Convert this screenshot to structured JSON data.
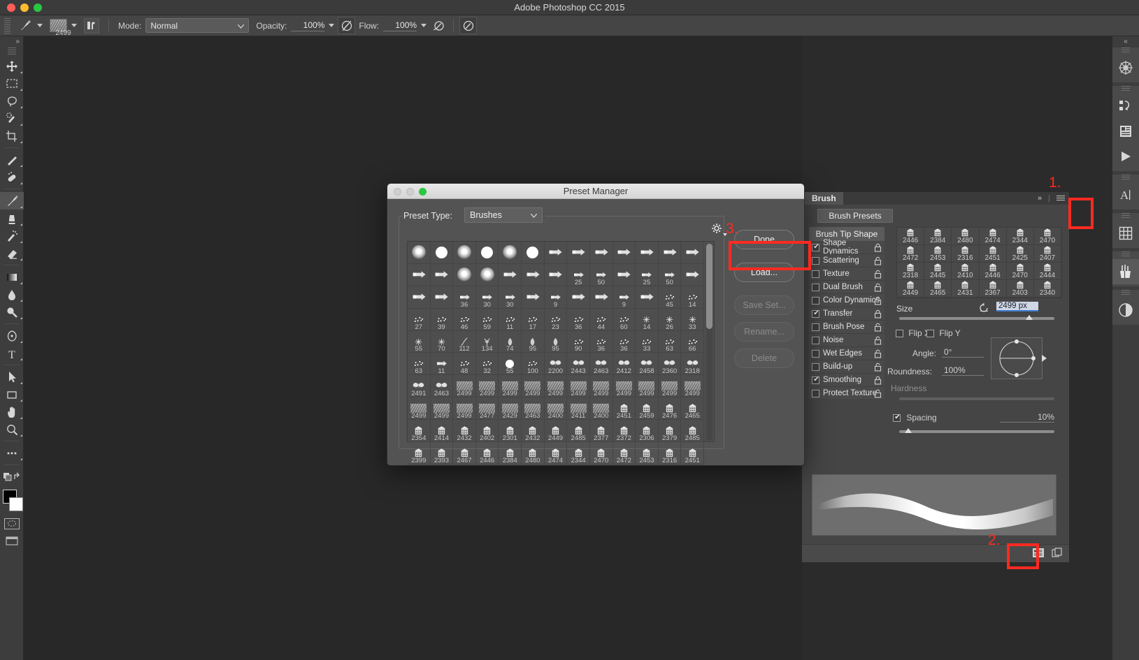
{
  "window": {
    "app_title": "Adobe Photoshop CC 2015"
  },
  "options_bar": {
    "brush_preset_size": "2499",
    "mode_label": "Mode:",
    "mode_value": "Normal",
    "opacity_label": "Opacity:",
    "opacity_value": "100%",
    "flow_label": "Flow:",
    "flow_value": "100%",
    "icons": {
      "brush_tool": "brush-icon",
      "brush_preset": "brush-preset-thumbnail",
      "toggle_brush_panel": "brush-panel-toggle-icon",
      "airbrush": "airbrush-icon",
      "tablet_pressure_opacity": "tablet-pressure-opacity-icon",
      "tablet_pressure_size": "tablet-pressure-size-icon",
      "smoothing_options": "smoothing-options-icon"
    }
  },
  "toolbar": {
    "collapse": "»",
    "tools": [
      {
        "name": "move-tool",
        "glyph": "move"
      },
      {
        "name": "rectangular-marquee-tool",
        "glyph": "marquee"
      },
      {
        "name": "lasso-tool",
        "glyph": "lasso"
      },
      {
        "name": "quick-selection-tool",
        "glyph": "quickselect"
      },
      {
        "name": "crop-tool",
        "glyph": "crop"
      },
      {
        "name": "eyedropper-tool",
        "glyph": "eyedropper"
      },
      {
        "name": "spot-healing-brush-tool",
        "glyph": "healing"
      },
      {
        "name": "brush-tool",
        "glyph": "brush",
        "selected": true
      },
      {
        "name": "clone-stamp-tool",
        "glyph": "stamp"
      },
      {
        "name": "history-brush-tool",
        "glyph": "historybrush"
      },
      {
        "name": "eraser-tool",
        "glyph": "eraser"
      },
      {
        "name": "gradient-tool",
        "glyph": "gradient"
      },
      {
        "name": "blur-tool",
        "glyph": "blur"
      },
      {
        "name": "dodge-tool",
        "glyph": "dodge"
      },
      {
        "name": "pen-tool",
        "glyph": "pen"
      },
      {
        "name": "type-tool",
        "glyph": "type"
      },
      {
        "name": "path-selection-tool",
        "glyph": "pathselect"
      },
      {
        "name": "rectangle-tool",
        "glyph": "rect"
      },
      {
        "name": "hand-tool",
        "glyph": "hand"
      },
      {
        "name": "zoom-tool",
        "glyph": "zoom"
      },
      {
        "name": "edit-toolbar-button",
        "glyph": "ellipsis"
      }
    ],
    "foreground_color": "#000000",
    "background_color": "#ffffff"
  },
  "preset_manager": {
    "title": "Preset Manager",
    "preset_type_label": "Preset Type:",
    "preset_type_value": "Brushes",
    "gear_icon": "gear-icon",
    "buttons": [
      {
        "label": "Done",
        "enabled": true
      },
      {
        "label": "Load...",
        "enabled": true
      },
      {
        "label": "Save Set...",
        "enabled": false
      },
      {
        "label": "Rename...",
        "enabled": false
      },
      {
        "label": "Delete",
        "enabled": false
      }
    ],
    "brush_rows": [
      [
        {
          "k": "soft",
          "n": ""
        },
        {
          "k": "hard",
          "n": ""
        },
        {
          "k": "soft",
          "n": ""
        },
        {
          "k": "hard",
          "n": ""
        },
        {
          "k": "soft",
          "n": ""
        },
        {
          "k": "hard",
          "n": ""
        },
        {
          "k": "flat",
          "n": ""
        },
        {
          "k": "flat",
          "n": ""
        },
        {
          "k": "flat",
          "n": ""
        },
        {
          "k": "flat",
          "n": ""
        },
        {
          "k": "flat",
          "n": ""
        },
        {
          "k": "flat",
          "n": ""
        },
        {
          "k": "flat",
          "n": ""
        }
      ],
      [
        {
          "k": "flat",
          "n": ""
        },
        {
          "k": "flat",
          "n": ""
        },
        {
          "k": "soft",
          "n": ""
        },
        {
          "k": "soft",
          "n": ""
        },
        {
          "k": "flat",
          "n": ""
        },
        {
          "k": "flat",
          "n": ""
        },
        {
          "k": "flat",
          "n": ""
        },
        {
          "k": "flat",
          "n": "25"
        },
        {
          "k": "flat",
          "n": "50"
        },
        {
          "k": "flat",
          "n": ""
        },
        {
          "k": "flat",
          "n": "25"
        },
        {
          "k": "flat",
          "n": "50"
        },
        {
          "k": "flat",
          "n": ""
        }
      ],
      [
        {
          "k": "flat",
          "n": ""
        },
        {
          "k": "flat",
          "n": ""
        },
        {
          "k": "flat",
          "n": "36"
        },
        {
          "k": "flat",
          "n": "30"
        },
        {
          "k": "flat",
          "n": "30"
        },
        {
          "k": "flat",
          "n": ""
        },
        {
          "k": "flat",
          "n": "9"
        },
        {
          "k": "flat",
          "n": ""
        },
        {
          "k": "flat",
          "n": ""
        },
        {
          "k": "flat",
          "n": "9"
        },
        {
          "k": "flat",
          "n": ""
        },
        {
          "k": "spray",
          "n": "45"
        },
        {
          "k": "spray",
          "n": "14"
        }
      ],
      [
        {
          "k": "spray",
          "n": "27"
        },
        {
          "k": "spray",
          "n": "39"
        },
        {
          "k": "spray",
          "n": "46"
        },
        {
          "k": "spray",
          "n": "59"
        },
        {
          "k": "spray",
          "n": "11"
        },
        {
          "k": "spray",
          "n": "17"
        },
        {
          "k": "spray",
          "n": "23"
        },
        {
          "k": "spray",
          "n": "36"
        },
        {
          "k": "spray",
          "n": "44"
        },
        {
          "k": "spray",
          "n": "60"
        },
        {
          "k": "dot",
          "n": "14"
        },
        {
          "k": "dot",
          "n": "26"
        },
        {
          "k": "dot",
          "n": "33"
        }
      ],
      [
        {
          "k": "dot",
          "n": "55"
        },
        {
          "k": "dot",
          "n": "70"
        },
        {
          "k": "stroke",
          "n": "112"
        },
        {
          "k": "grass",
          "n": "134"
        },
        {
          "k": "leaf",
          "n": "74"
        },
        {
          "k": "leaf",
          "n": "95"
        },
        {
          "k": "leaf",
          "n": "95"
        },
        {
          "k": "spray",
          "n": "90"
        },
        {
          "k": "spray",
          "n": "36"
        },
        {
          "k": "spray",
          "n": "36"
        },
        {
          "k": "spray",
          "n": "33"
        },
        {
          "k": "spray",
          "n": "63"
        },
        {
          "k": "spray",
          "n": "66"
        }
      ],
      [
        {
          "k": "spray",
          "n": "63"
        },
        {
          "k": "flat",
          "n": "11"
        },
        {
          "k": "spray",
          "n": "48"
        },
        {
          "k": "spray",
          "n": "32"
        },
        {
          "k": "hard",
          "n": "55"
        },
        {
          "k": "spray",
          "n": "100"
        },
        {
          "k": "moth",
          "n": "2200"
        },
        {
          "k": "moth",
          "n": "2443"
        },
        {
          "k": "moth",
          "n": "2463"
        },
        {
          "k": "moth",
          "n": "2412"
        },
        {
          "k": "moth",
          "n": "2458"
        },
        {
          "k": "moth",
          "n": "2360"
        },
        {
          "k": "moth",
          "n": "2318"
        }
      ],
      [
        {
          "k": "moth",
          "n": "2491"
        },
        {
          "k": "moth",
          "n": "2463"
        },
        {
          "k": "tex",
          "n": "2499"
        },
        {
          "k": "tex",
          "n": "2499"
        },
        {
          "k": "tex",
          "n": "2499"
        },
        {
          "k": "tex",
          "n": "2499"
        },
        {
          "k": "tex",
          "n": "2499"
        },
        {
          "k": "tex",
          "n": "2499"
        },
        {
          "k": "tex",
          "n": "2499"
        },
        {
          "k": "tex",
          "n": "2499"
        },
        {
          "k": "tex",
          "n": "2499"
        },
        {
          "k": "tex",
          "n": "2499"
        },
        {
          "k": "tex",
          "n": "2499"
        }
      ],
      [
        {
          "k": "tex",
          "n": "2499"
        },
        {
          "k": "tex",
          "n": "2499"
        },
        {
          "k": "tex",
          "n": "2499"
        },
        {
          "k": "tex",
          "n": "2477"
        },
        {
          "k": "tex",
          "n": "2429"
        },
        {
          "k": "tex",
          "n": "2463"
        },
        {
          "k": "tex",
          "n": "2400"
        },
        {
          "k": "tex",
          "n": "2411"
        },
        {
          "k": "tex",
          "n": "2400"
        },
        {
          "k": "bldg",
          "n": "2451"
        },
        {
          "k": "bldg",
          "n": "2459"
        },
        {
          "k": "bldg",
          "n": "2476"
        },
        {
          "k": "bldg",
          "n": "2465"
        }
      ],
      [
        {
          "k": "bldg",
          "n": "2354"
        },
        {
          "k": "bldg",
          "n": "2414"
        },
        {
          "k": "bldg",
          "n": "2432"
        },
        {
          "k": "bldg",
          "n": "2402"
        },
        {
          "k": "bldg",
          "n": "2301"
        },
        {
          "k": "bldg",
          "n": "2432"
        },
        {
          "k": "bldg",
          "n": "2449"
        },
        {
          "k": "bldg",
          "n": "2485"
        },
        {
          "k": "bldg",
          "n": "2377"
        },
        {
          "k": "bldg",
          "n": "2372"
        },
        {
          "k": "bldg",
          "n": "2306"
        },
        {
          "k": "bldg",
          "n": "2379"
        },
        {
          "k": "bldg",
          "n": "2485"
        }
      ],
      [
        {
          "k": "bldg",
          "n": "2399"
        },
        {
          "k": "bldg",
          "n": "2393"
        },
        {
          "k": "bldg",
          "n": "2467"
        },
        {
          "k": "bldg",
          "n": "2446"
        },
        {
          "k": "bldg",
          "n": "2384"
        },
        {
          "k": "bldg",
          "n": "2480"
        },
        {
          "k": "bldg",
          "n": "2474"
        },
        {
          "k": "bldg",
          "n": "2344"
        },
        {
          "k": "bldg",
          "n": "2470"
        },
        {
          "k": "bldg",
          "n": "2472"
        },
        {
          "k": "bldg",
          "n": "2453"
        },
        {
          "k": "bldg",
          "n": "2316"
        },
        {
          "k": "bldg",
          "n": "2451"
        }
      ]
    ]
  },
  "brush_panel": {
    "tab_label": "Brush",
    "collapse_icon": "»",
    "menu_icon": "panel-menu-icon",
    "presets_button": "Brush Presets",
    "tip_shape_header": "Brush Tip Shape",
    "options": [
      {
        "label": "Shape Dynamics",
        "checked": true
      },
      {
        "label": "Scattering",
        "checked": false
      },
      {
        "label": "Texture",
        "checked": false
      },
      {
        "label": "Dual Brush",
        "checked": false
      },
      {
        "label": "Color Dynamics",
        "checked": false
      },
      {
        "label": "Transfer",
        "checked": true
      },
      {
        "label": "Brush Pose",
        "checked": false
      },
      {
        "label": "Noise",
        "checked": false
      },
      {
        "label": "Wet Edges",
        "checked": false
      },
      {
        "label": "Build-up",
        "checked": false
      },
      {
        "label": "Smoothing",
        "checked": true
      },
      {
        "label": "Protect Texture",
        "checked": false
      }
    ],
    "tip_grid": [
      [
        {
          "n": "2446"
        },
        {
          "n": "2384"
        },
        {
          "n": "2480"
        },
        {
          "n": "2474"
        },
        {
          "n": "2344"
        },
        {
          "n": "2470"
        }
      ],
      [
        {
          "n": "2472"
        },
        {
          "n": "2453"
        },
        {
          "n": "2316"
        },
        {
          "n": "2451"
        },
        {
          "n": "2425"
        },
        {
          "n": "2407"
        }
      ],
      [
        {
          "n": "2318"
        },
        {
          "n": "2445"
        },
        {
          "n": "2410"
        },
        {
          "n": "2446"
        },
        {
          "n": "2470"
        },
        {
          "n": "2444"
        }
      ],
      [
        {
          "n": "2449"
        },
        {
          "n": "2465"
        },
        {
          "n": "2431"
        },
        {
          "n": "2367"
        },
        {
          "n": "2403"
        },
        {
          "n": "2340"
        }
      ]
    ],
    "size_label": "Size",
    "size_value": "2499 px",
    "reset_icon": "reset-arrow-icon",
    "flip_x_label": "Flip X",
    "flip_x_checked": false,
    "flip_y_label": "Flip Y",
    "flip_y_checked": false,
    "angle_label": "Angle:",
    "angle_value": "0°",
    "roundness_label": "Roundness:",
    "roundness_value": "100%",
    "hardness_label": "Hardness",
    "spacing_label": "Spacing",
    "spacing_checked": true,
    "spacing_value": "10%",
    "footer_icons": [
      {
        "name": "toggle-brush-settings-icon"
      },
      {
        "name": "new-brush-preset-icon"
      }
    ]
  },
  "icon_dock": {
    "collapse_icon": "«",
    "groups": [
      [
        {
          "name": "3d-panel-icon"
        }
      ],
      [
        {
          "name": "history-panel-icon"
        },
        {
          "name": "properties-panel-icon"
        },
        {
          "name": "timeline-play-icon"
        }
      ],
      [
        {
          "name": "character-panel-icon"
        }
      ],
      [
        {
          "name": "swatches-grid-icon"
        }
      ],
      [
        {
          "name": "brushes-panel-icon",
          "selected": true
        }
      ],
      [
        {
          "name": "adjustments-panel-icon"
        }
      ]
    ]
  },
  "annotations": [
    {
      "number": "1.",
      "target": "brushes-panel-dock-icon"
    },
    {
      "number": "2.",
      "target": "toggle-brush-settings-footer-icon"
    },
    {
      "number": "3.",
      "target": "load-button"
    }
  ]
}
